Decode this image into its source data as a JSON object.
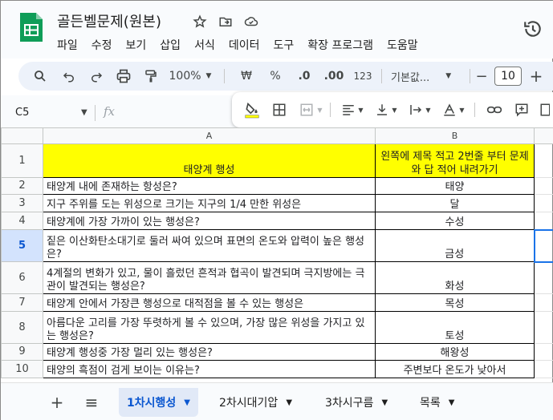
{
  "app": {
    "title": "골든벨문제(원본)"
  },
  "menu": [
    "파일",
    "수정",
    "보기",
    "삽입",
    "서식",
    "데이터",
    "도구",
    "확장 프로그램",
    "도움말"
  ],
  "toolbar": {
    "zoom": "100%",
    "currency": "₩",
    "percent": "%",
    "decrease_decimal": ".0",
    "increase_decimal": ".00",
    "number_format": "123",
    "font": "기본값...",
    "minus": "−",
    "font_size": "10",
    "plus": "+"
  },
  "formula_bar": {
    "cell_ref": "C5",
    "fx": "fx"
  },
  "grid": {
    "columns": [
      "A",
      "B"
    ],
    "header_row": {
      "row": "1",
      "a": "태양계 행성",
      "b": "왼쪽에 제목 적고 2번줄 부터 문제와 답 적어 내려가기"
    },
    "rows": [
      {
        "row": "2",
        "a": "태양계 내에 존재하는 항성은?",
        "b": "태양"
      },
      {
        "row": "3",
        "a": "지구 주위를 도는 위성으로 크기는 지구의 1/4 만한 위성은",
        "b": "달"
      },
      {
        "row": "4",
        "a": "태양계에 가장 가까이 있는 행성은?",
        "b": "수성"
      },
      {
        "row": "5",
        "a": "짙은 이산화탄소대기로 둘러 싸여 있으며 표면의 온도와 압력이 높은 행성은?",
        "b": "금성"
      },
      {
        "row": "6",
        "a": "4계절의 변화가 있고, 물이 흘렀던 흔적과 협곡이 발견되며 극지방에는 극관이 발견되는 행성은?",
        "b": "화성"
      },
      {
        "row": "7",
        "a": "태양계 안에서 가장큰 행성으로 대적점을 볼 수 있는 행성은",
        "b": "목성"
      },
      {
        "row": "8",
        "a": "아름다운 고리를 가장 뚜렷하게 볼 수 있으며, 가장 많은 위성을 가지고 있는 행성은?",
        "b": "토성"
      },
      {
        "row": "9",
        "a": "태양계 행성중 가장 멀리 있는 행성은?",
        "b": "해왕성"
      },
      {
        "row": "10",
        "a": "태양의 흑점이 검게 보이는 이유는?",
        "b": "주변보다 온도가 낮아서"
      }
    ]
  },
  "sheets": {
    "add": "+",
    "list": "≡",
    "tabs": [
      {
        "label": "1차시행성",
        "active": true
      },
      {
        "label": "2차시대기압",
        "active": false
      },
      {
        "label": "3차시구름",
        "active": false
      },
      {
        "label": "목록",
        "active": false
      }
    ]
  }
}
